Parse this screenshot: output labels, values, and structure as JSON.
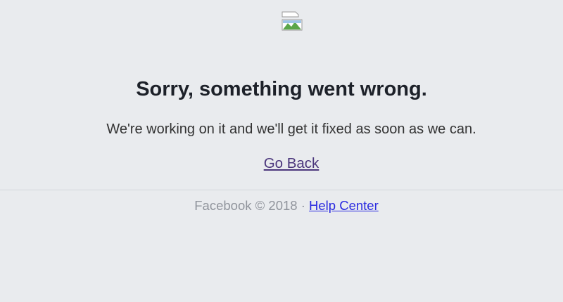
{
  "error": {
    "title": "Sorry, something went wrong.",
    "message": "We're working on it and we'll get it fixed as soon as we can.",
    "go_back_label": "Go Back"
  },
  "footer": {
    "copyright": "Facebook © 2018",
    "separator": " · ",
    "help_center_label": "Help Center"
  },
  "colors": {
    "background": "#e9ebee",
    "visited_link": "#4b367c",
    "link": "#2a2ae0",
    "muted_text": "#90949c"
  }
}
